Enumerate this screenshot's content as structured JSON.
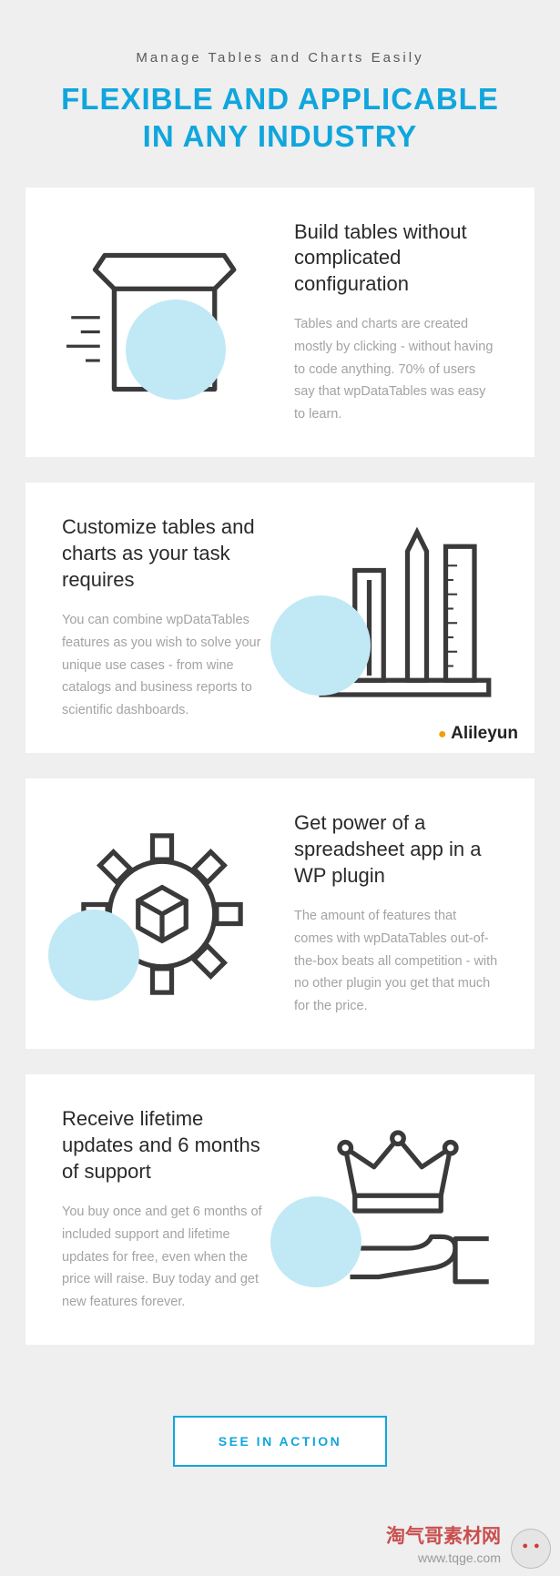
{
  "header": {
    "sub": "Manage Tables and Charts Easily",
    "title_l1": "FLEXIBLE AND APPLICABLE",
    "title_l2": "IN ANY INDUSTRY"
  },
  "cards": [
    {
      "h": "Build tables without complicated configuration",
      "p": "Tables and charts are created mostly by clicking - without having to code anything. 70% of users say that wpDataTables was easy to learn."
    },
    {
      "h": "Customize tables and charts as your task requires",
      "p": "You can combine wpDataTables features as you wish to solve your unique use cases - from wine catalogs and business reports to scientific dashboards."
    },
    {
      "h": "Get power of a spreadsheet app in a WP plugin",
      "p": "The amount of features that comes with wpDataTables out-of-the-box beats all competition - with no other plugin you get that much for the price."
    },
    {
      "h": "Receive lifetime updates and 6 months of support",
      "p": "You buy once and get 6 months of included support and lifetime updates for free, even when the price will raise. Buy today and get new features forever."
    }
  ],
  "watermark": {
    "brand": "Alileyun",
    "o": "alile",
    "b": "yun"
  },
  "cta": "SEE IN ACTION",
  "footer": {
    "brand": "淘气哥素材网",
    "url": "www.tqge.com"
  }
}
